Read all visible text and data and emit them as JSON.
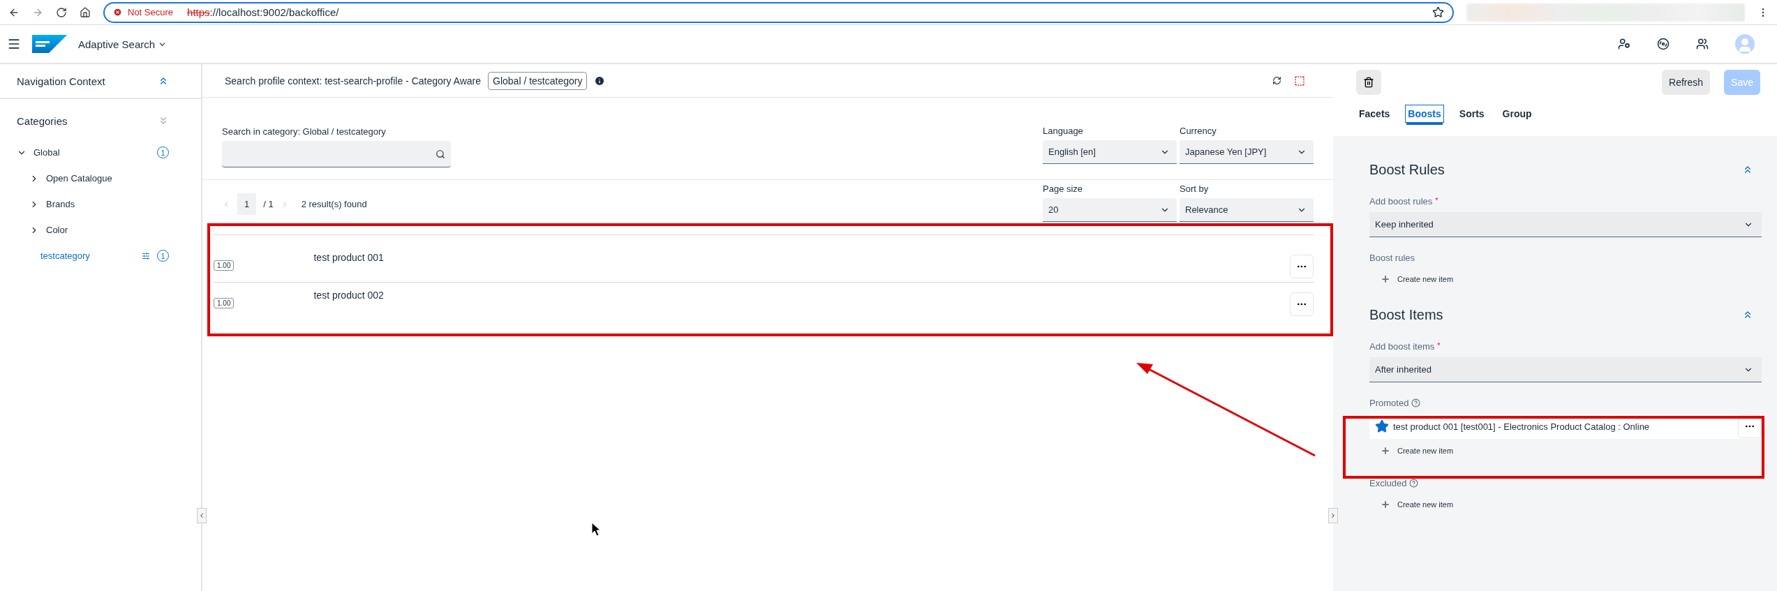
{
  "browser": {
    "security_label": "Not Secure",
    "url_scheme": "https",
    "url_rest": "://localhost:9002/backoffice/"
  },
  "app": {
    "title": "Adaptive Search"
  },
  "navigation": {
    "title": "Navigation Context",
    "categories_title": "Categories",
    "tree": [
      {
        "label": "Global",
        "kind": "branch",
        "expanded": true,
        "selected": false,
        "badge": "1",
        "children": [
          {
            "label": "Open Catalogue",
            "kind": "branch",
            "expanded": false,
            "selected": false
          },
          {
            "label": "Brands",
            "kind": "branch",
            "expanded": false,
            "selected": false
          },
          {
            "label": "Color",
            "kind": "branch",
            "expanded": false,
            "selected": false
          },
          {
            "label": "testcategory",
            "kind": "leaf",
            "selected": true,
            "badge": "1"
          }
        ]
      }
    ]
  },
  "context": {
    "label": "Search profile context: test-search-profile - Category Aware",
    "category": "Global / testcategory"
  },
  "search": {
    "label": "Search in category: Global / testcategory"
  },
  "filters": [
    {
      "label": "Language",
      "value": "English [en]"
    },
    {
      "label": "Currency",
      "value": "Japanese Yen [JPY]"
    }
  ],
  "pager": {
    "page": "1",
    "total": "/ 1",
    "results": "2 result(s) found"
  },
  "sort_filters": [
    {
      "label": "Page size",
      "value": "20"
    },
    {
      "label": "Sort by",
      "value": "Relevance"
    }
  ],
  "results": [
    {
      "score": "1.00",
      "name": "test product 001"
    },
    {
      "score": "1.00",
      "name": "test product 002"
    }
  ],
  "actions": {
    "refresh": "Refresh",
    "save": "Save",
    "save_disabled": true
  },
  "tabs": [
    {
      "label": "Facets",
      "selected": false
    },
    {
      "label": "Boosts",
      "selected": true
    },
    {
      "label": "Sorts",
      "selected": false
    },
    {
      "label": "Group",
      "selected": false
    }
  ],
  "sections": [
    {
      "title": "Boost Rules",
      "expanded": true,
      "select": {
        "label": "Add boost rules",
        "required_mark": "*",
        "value": "Keep inherited"
      },
      "lists": [
        {
          "label": "Boost rules",
          "help": false,
          "create": "Create new item"
        }
      ]
    },
    {
      "title": "Boost Items",
      "expanded": true,
      "select": {
        "label": "Add boost items",
        "required_mark": "*",
        "value": "After inherited"
      },
      "lists": [
        {
          "label": "Promoted",
          "help": true,
          "items": [
            {
              "text": "test product 001 [test001] - Electronics Product Catalog : Online",
              "starred": true
            }
          ],
          "create": "Create new item"
        },
        {
          "label": "Excluded",
          "help": true,
          "create": "Create new item"
        }
      ]
    }
  ]
}
